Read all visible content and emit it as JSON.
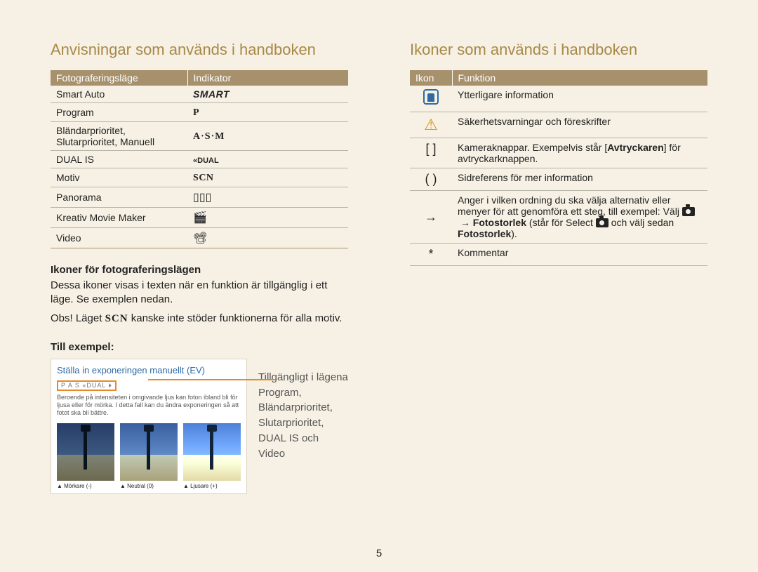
{
  "page_number": "5",
  "left": {
    "heading": "Anvisningar som används i handboken",
    "table_headers": {
      "c1": "Fotograferingsläge",
      "c2": "Indikator"
    },
    "rows": [
      {
        "mode": "Smart Auto",
        "indicator": "SMART",
        "cls": "ind-smart"
      },
      {
        "mode": "Program",
        "indicator": "P",
        "cls": "ind-p"
      },
      {
        "mode": "Bländarprioritet, Slutarprioritet, Manuell",
        "indicator": "A·S·M",
        "cls": "ind-asm"
      },
      {
        "mode": "DUAL IS",
        "indicator": "«DUAL",
        "cls": "ind-dual"
      },
      {
        "mode": "Motiv",
        "indicator": "SCN",
        "cls": "ind-scn"
      },
      {
        "mode": "Panorama",
        "indicator": "▯▯▯",
        "cls": "icon-block"
      },
      {
        "mode": "Kreativ Movie Maker",
        "indicator": "🎬",
        "cls": "icon-block"
      },
      {
        "mode": "Video",
        "indicator": "📽",
        "cls": "icon-block"
      }
    ],
    "sub1": "Ikoner för fotograferingslägen",
    "p1": "Dessa ikoner visas i texten när en funktion är tillgänglig i ett läge. Se exemplen nedan.",
    "p2a": "Obs! Läget ",
    "p2_scn": "SCN",
    "p2b": " kanske inte stöder funktionerna för alla motiv.",
    "sub2": "Till exempel:",
    "panel": {
      "title": "Ställa in exponeringen manuellt (EV)",
      "badges": "P  A  S  «DUAL  ⏵",
      "lead": "Beroende på intensiteten i omgivande ljus kan foton ibland bli för ljusa eller för mörka. I detta fall kan du ändra exponeringen så att fotot ska bli bättre.",
      "thumbs": [
        {
          "cap": "▲ Mörkare (-)"
        },
        {
          "cap": "▲ Neutral (0)"
        },
        {
          "cap": "▲ Ljusare (+)"
        }
      ]
    },
    "example_side": "Tillgängligt i lägena Program, Bländarprioritet, Slutarprioritet, DUAL IS och Video"
  },
  "right": {
    "heading": "Ikoner som används i handboken",
    "table_headers": {
      "c1": "Ikon",
      "c2": "Funktion"
    },
    "rows": [
      {
        "icon_kind": "note",
        "text": "Ytterligare information"
      },
      {
        "icon_kind": "warn",
        "text": "Säkerhetsvarningar och föreskrifter"
      },
      {
        "icon_kind": "bracket",
        "symbol": "[  ]",
        "pre": "Kameraknappar. Exempelvis står [",
        "bold": "Avtryckaren",
        "post": "] för avtryckarknappen."
      },
      {
        "icon_kind": "paren",
        "symbol": "(  )",
        "text": "Sidreferens för mer information"
      },
      {
        "icon_kind": "arrow",
        "symbol": "→",
        "line1": "Anger i vilken ordning du ska välja alternativ eller menyer för att genomföra ett steg, till exempel: Välj ",
        "b1": "Fotostorlek",
        "mid": " (står för Select ",
        "after_cam": " och välj sedan ",
        "b2": "Fotostorlek",
        "end": ")."
      },
      {
        "icon_kind": "star",
        "symbol": "*",
        "text": "Kommentar"
      }
    ]
  }
}
